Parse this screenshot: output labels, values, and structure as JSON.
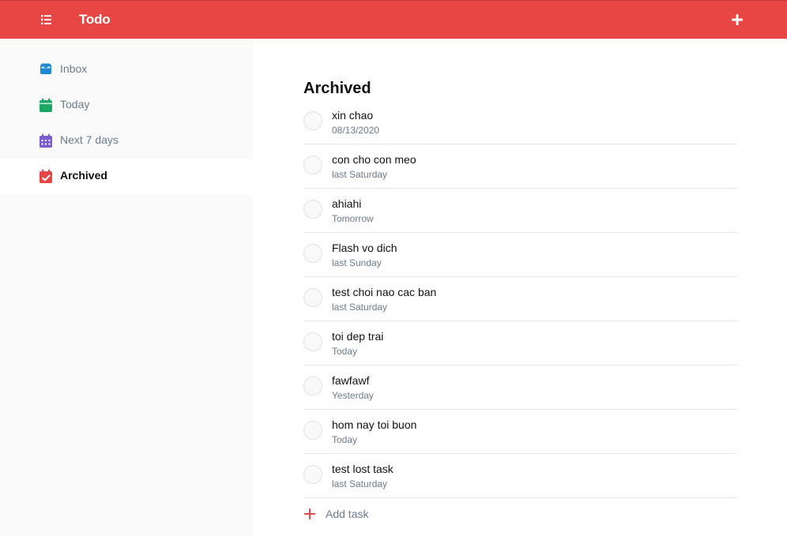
{
  "header": {
    "menu_icon": "list-icon",
    "title": "Todo",
    "add_icon": "plus-icon"
  },
  "sidebar": {
    "items": [
      {
        "label": "Inbox",
        "icon": "inbox-icon",
        "color": "#1e88d0"
      },
      {
        "label": "Today",
        "icon": "calendar-today-icon",
        "color": "#1aa862"
      },
      {
        "label": "Next 7 days",
        "icon": "calendar-week-icon",
        "color": "#7b5ccc"
      },
      {
        "label": "Archived",
        "icon": "calendar-check-icon",
        "color": "#e84644"
      }
    ],
    "active": "Archived"
  },
  "main": {
    "title": "Archived",
    "tasks": [
      {
        "title": "xin chao",
        "date": "08/13/2020"
      },
      {
        "title": "con cho con meo",
        "date": "last Saturday"
      },
      {
        "title": "ahiahi",
        "date": "Tomorrow"
      },
      {
        "title": "Flash vo dich",
        "date": "last Sunday"
      },
      {
        "title": "test choi nao cac ban",
        "date": "last Saturday"
      },
      {
        "title": "toi dep trai",
        "date": "Today"
      },
      {
        "title": "fawfawf",
        "date": "Yesterday"
      },
      {
        "title": "hom nay toi buon",
        "date": "Today"
      },
      {
        "title": "test lost task",
        "date": "last Saturday"
      }
    ],
    "add_task_label": "Add task"
  },
  "colors": {
    "brand": "#e84644",
    "sidebar_bg": "#fafafa",
    "muted_text": "#6c7a8a"
  }
}
